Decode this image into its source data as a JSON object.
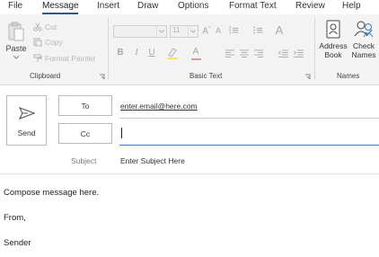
{
  "tabs": [
    {
      "label": "File"
    },
    {
      "label": "Message"
    },
    {
      "label": "Insert"
    },
    {
      "label": "Draw"
    },
    {
      "label": "Options"
    },
    {
      "label": "Format Text"
    },
    {
      "label": "Review"
    },
    {
      "label": "Help"
    }
  ],
  "active_tab": "Message",
  "ribbon": {
    "clipboard": {
      "paste": "Paste",
      "cut": "Cut",
      "copy": "Copy",
      "format_painter": "Format Painter",
      "group_label": "Clipboard"
    },
    "basic_text": {
      "font_name": "",
      "font_size": "11",
      "bold": "B",
      "italic": "I",
      "underline": "U",
      "group_label": "Basic Text"
    },
    "names": {
      "address_book_line1": "Address",
      "address_book_line2": "Book",
      "check_names_line1": "Check",
      "check_names_line2": "Names",
      "group_label": "Names"
    }
  },
  "compose": {
    "send_label": "Send",
    "to_label": "To",
    "cc_label": "Cc",
    "to_value": "enter.email@here.com",
    "cc_value": "",
    "subject_label": "Subject",
    "subject_value": "Enter Subject Here",
    "body_lines": [
      "Compose message here.",
      "From,",
      "Sender"
    ]
  },
  "colors": {
    "accent": "#2b5797",
    "ribbon_bg": "#f3f3f3",
    "disabled": "#b6b6b6",
    "font_color_bar": "#c00000",
    "highlight_bar": "#ffff00"
  }
}
